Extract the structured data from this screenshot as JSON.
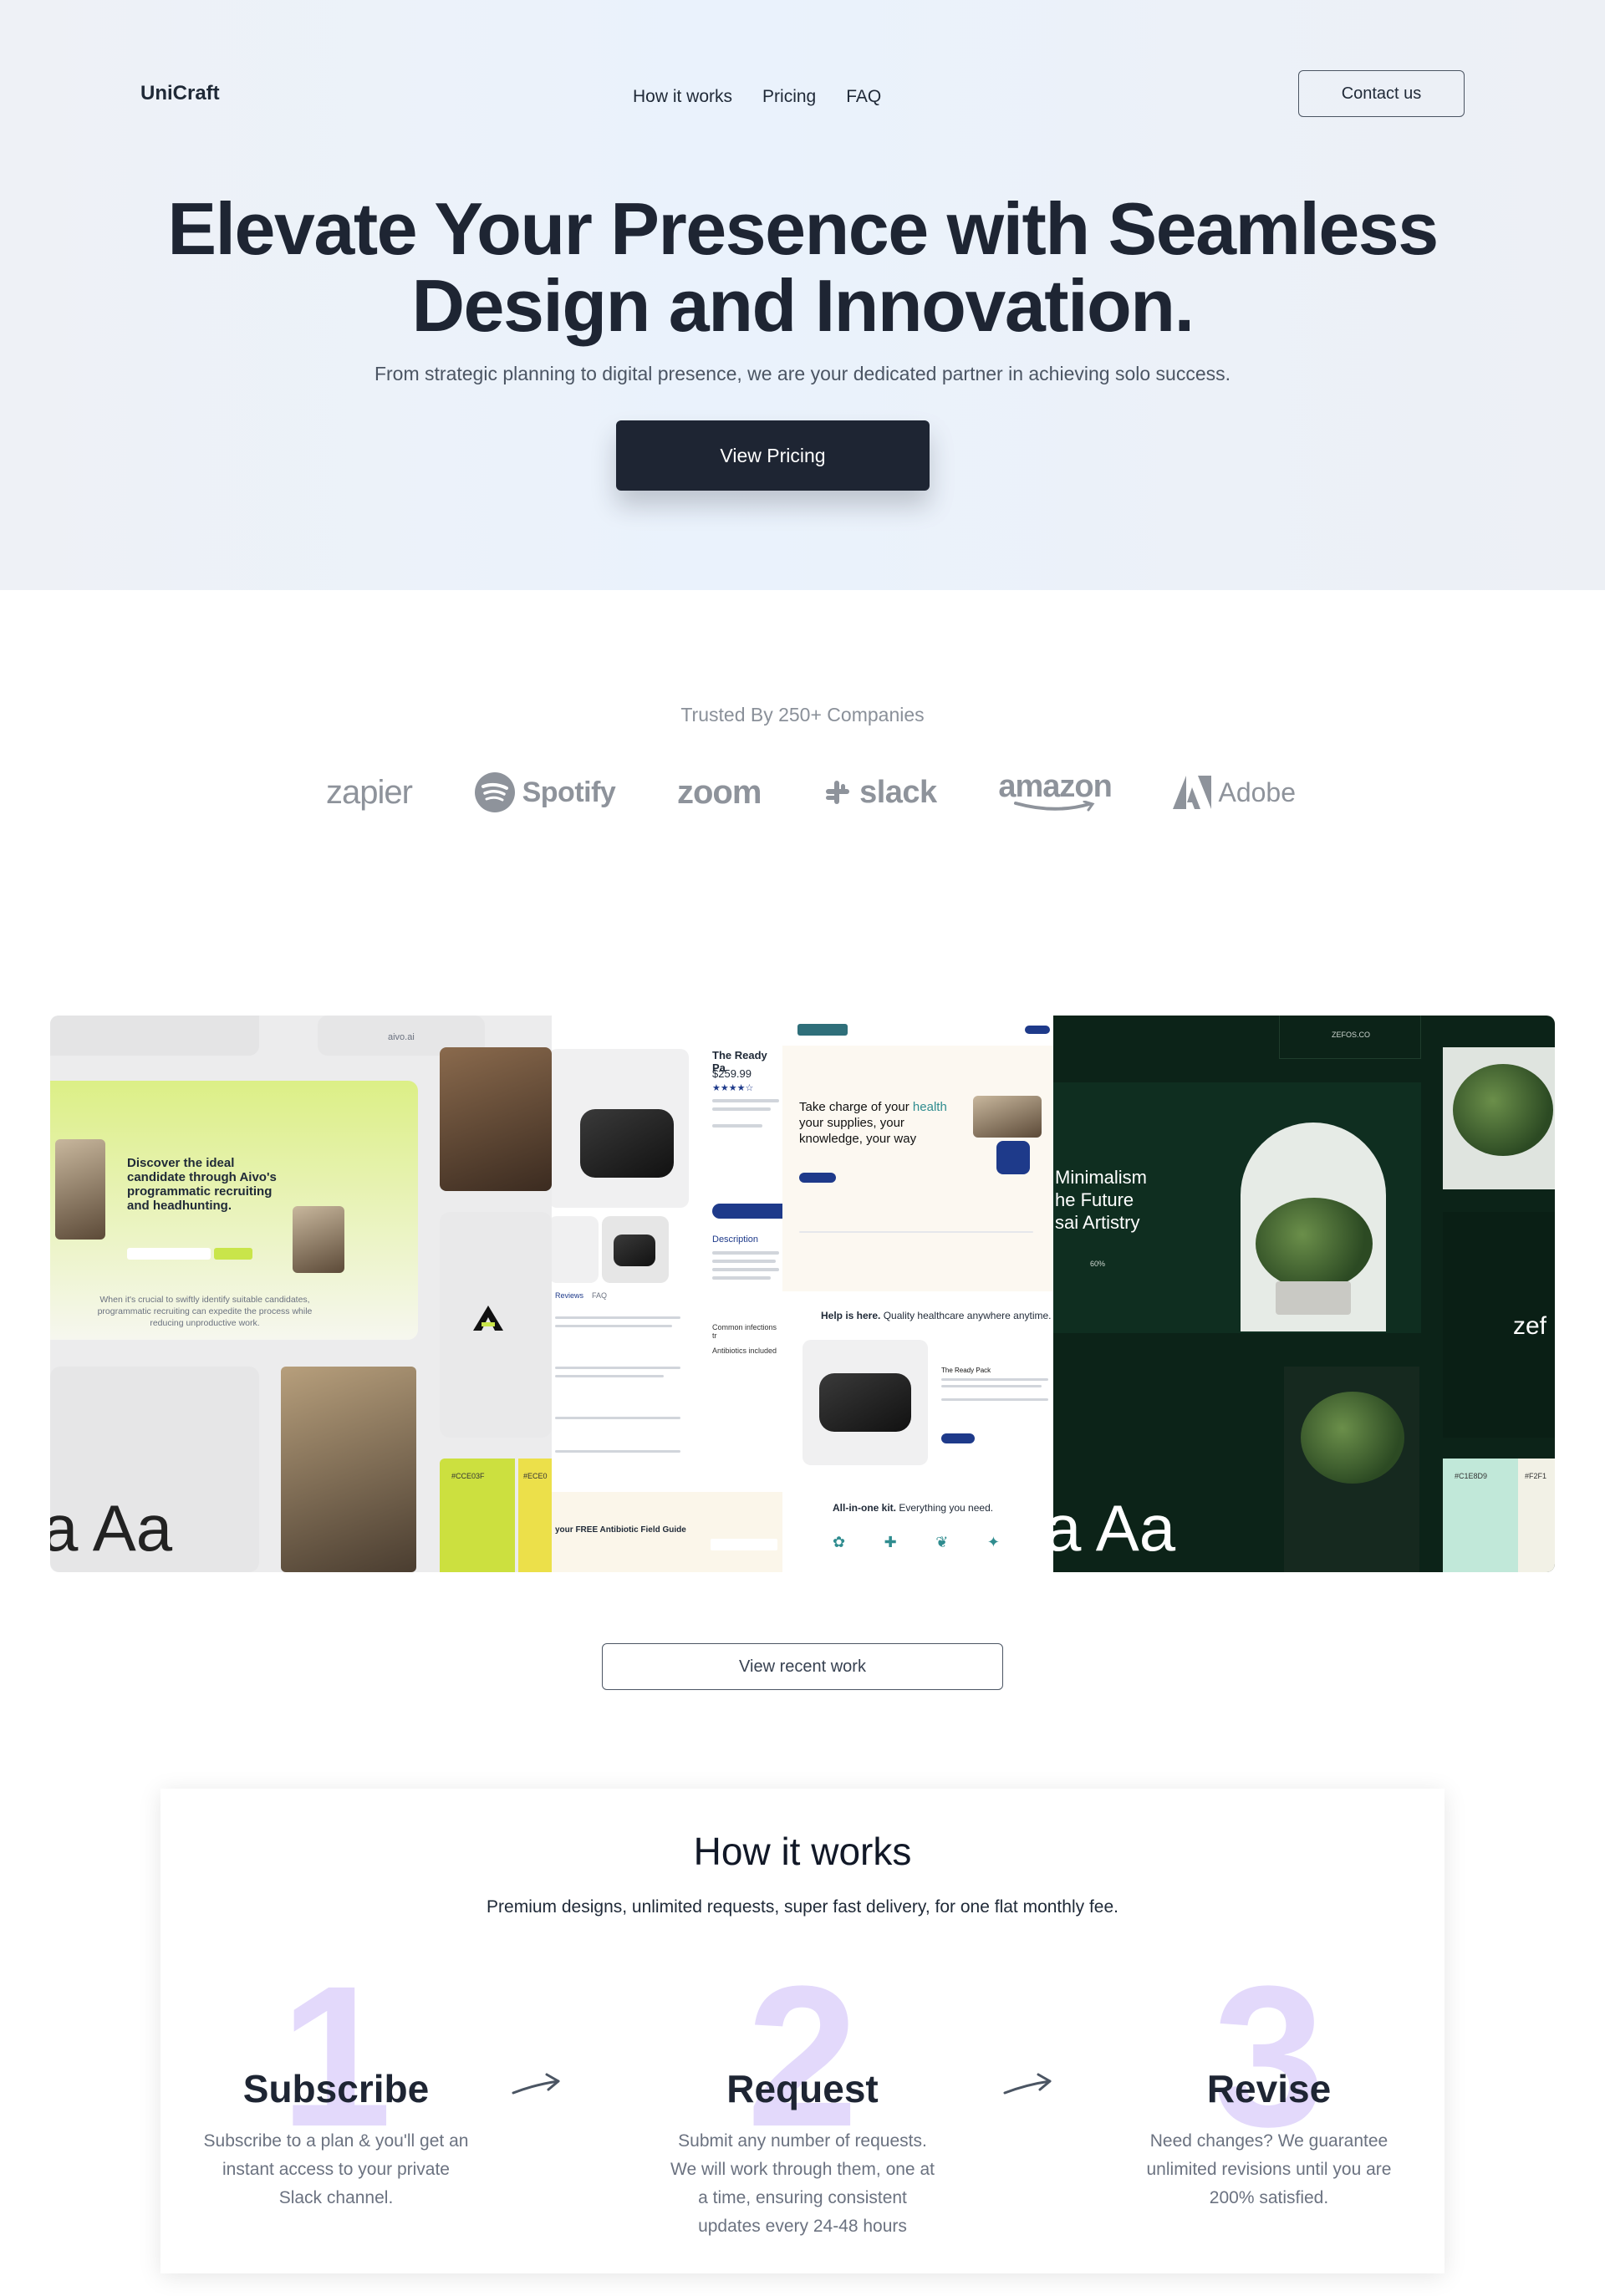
{
  "header": {
    "logo": "UniCraft",
    "nav": [
      "How it works",
      "Pricing",
      "FAQ"
    ],
    "contact_label": "Contact us"
  },
  "hero": {
    "title_line1": "Elevate Your Presence with Seamless",
    "title_line2": "Design and Innovation.",
    "subtitle": "From strategic planning to digital presence, we are your dedicated partner in achieving solo success.",
    "cta_label": "View Pricing"
  },
  "trusted": {
    "label": "Trusted By 250+ Companies",
    "brands": [
      "zapier",
      "Spotify",
      "zoom",
      "slack",
      "amazon",
      "Adobe"
    ]
  },
  "collage": {
    "aivo": {
      "nav_label": "aivo.ai",
      "headline1": "Discover the ideal",
      "headline2": "candidate through Aivo's",
      "headline3": "programmatic recruiting",
      "headline4": "and headhunting.",
      "body": "When it's crucial to swiftly identify suitable candidates, programmatic recruiting can expedite the process while reducing unproductive work.",
      "aa": "a Aa",
      "swatch1": "#CCE03F",
      "swatch2": "#ECE0"
    },
    "product": {
      "name": "The Ready Pa",
      "price": "$259.99",
      "desc_label": "Description",
      "infection_label": "Common infections tr",
      "antibiotics_label": "Antibiotics included",
      "reviews_label": "Reviews",
      "faq_label": "FAQ",
      "guide_label": "your FREE Antibiotic Field Guide"
    },
    "health": {
      "headline1": "Take charge of your",
      "headline_accent": "health",
      "headline2": "your supplies",
      "headline3": "your",
      "headline4": "knowledge",
      "headline5": "your way",
      "help": "Help is here.",
      "help_rest": "Quality healthcare anywhere anytime.",
      "product_label": "The Ready Pack",
      "kit": "All-in-one kit.",
      "kit_rest": "Everything you need."
    },
    "bonsai": {
      "site": "ZEFOS.CO",
      "headline1": "Minimalism",
      "headline2": "he Future",
      "headline3": "sai Artistry",
      "stat": "60%",
      "aa": "a Aa",
      "brand": "zef",
      "swatch1": "#C1E8D9",
      "swatch2": "#F2F1"
    }
  },
  "recent_work_label": "View recent work",
  "how": {
    "title": "How it works",
    "subtitle": "Premium designs, unlimited requests, super fast delivery, for one flat monthly fee.",
    "steps": [
      {
        "num": "1",
        "title": "Subscribe",
        "text": "Subscribe to a plan & you'll get an instant access to your private Slack channel."
      },
      {
        "num": "2",
        "title": "Request",
        "text": "Submit any number of requests. We will work through them, one at a time, ensuring consistent updates every 24-48 hours"
      },
      {
        "num": "3",
        "title": "Revise",
        "text": "Need changes? We guarantee unlimited revisions until you are 200% satisfied."
      }
    ]
  }
}
